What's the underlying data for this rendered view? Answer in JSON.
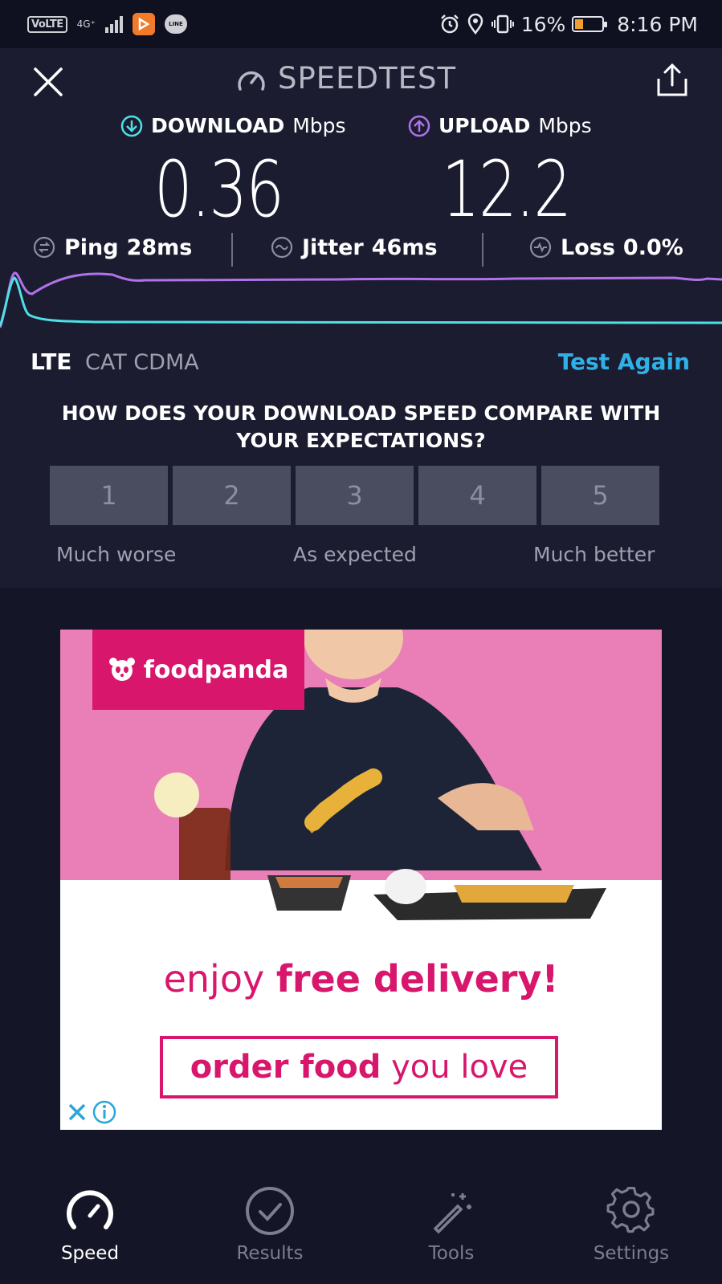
{
  "status_bar": {
    "volte": "VoLTE",
    "network": "4G⁺",
    "line_label": "LINE",
    "battery": "16%",
    "time": "8:16 PM",
    "icons": [
      "alarm-icon",
      "location-icon",
      "vibrate-icon",
      "battery-icon"
    ]
  },
  "header": {
    "title": "SPEEDTEST",
    "close_icon": "close-icon",
    "share_icon": "share-icon"
  },
  "metrics": {
    "download_label": "DOWNLOAD",
    "download_unit": "Mbps",
    "download_value": "0.36",
    "upload_label": "UPLOAD",
    "upload_unit": "Mbps",
    "upload_value": "12.2"
  },
  "stats": {
    "ping_label": "Ping",
    "ping_value": "28ms",
    "jitter_label": "Jitter",
    "jitter_value": "46ms",
    "loss_label": "Loss",
    "loss_value": "0.0%"
  },
  "network": {
    "type": "LTE",
    "carrier": "CAT CDMA",
    "test_again": "Test Again"
  },
  "survey": {
    "question": "HOW DOES YOUR DOWNLOAD SPEED COMPARE WITH YOUR EXPECTATIONS?",
    "ratings": [
      "1",
      "2",
      "3",
      "4",
      "5"
    ],
    "low_label": "Much worse",
    "mid_label": "As expected",
    "high_label": "Much better"
  },
  "ad": {
    "brand": "foodpanda",
    "line1_prefix": "enjoy",
    "line1_bold": "free delivery!",
    "line2_bold": "order food",
    "line2_rest": "you love"
  },
  "nav": {
    "speed": "Speed",
    "results": "Results",
    "tools": "Tools",
    "settings": "Settings"
  },
  "colors": {
    "download_accent": "#4fe0e6",
    "upload_accent": "#b072e8",
    "link": "#2fb1e8",
    "ad_brand": "#d7166c"
  }
}
